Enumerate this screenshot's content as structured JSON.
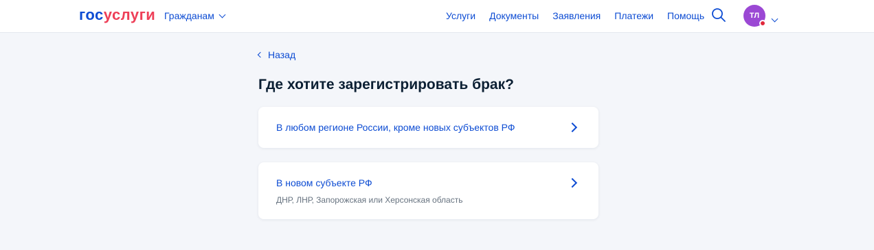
{
  "header": {
    "logo": {
      "gos": "гос",
      "uslugi": "услуги",
      "ru": ""
    },
    "audience_label": "Гражданам",
    "nav": [
      "Услуги",
      "Документы",
      "Заявления",
      "Платежи",
      "Помощь"
    ],
    "search_icon": "search-icon",
    "avatar_initials": "ТЛ",
    "accent_color": "#0d4cd3",
    "avatar_color": "#9b48d4"
  },
  "main": {
    "back_label": "Назад",
    "title": "Где хотите зарегистрировать брак?",
    "options": [
      {
        "title": "В любом регионе России, кроме новых субъектов РФ",
        "subtitle": ""
      },
      {
        "title": "В новом субъекте РФ",
        "subtitle": "ДНР, ЛНР, Запорожская или Херсонская область"
      }
    ]
  }
}
